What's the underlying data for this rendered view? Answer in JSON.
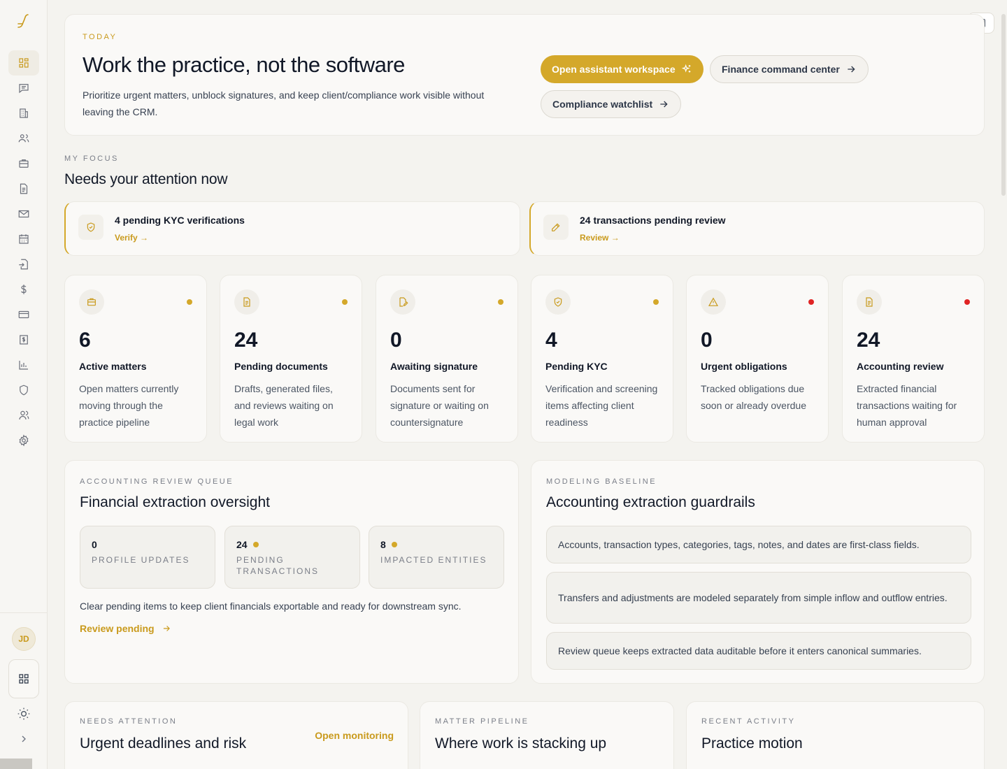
{
  "hero": {
    "eyebrow": "TODAY",
    "title": "Work the practice, not the software",
    "description": "Prioritize urgent matters, unblock signatures, and keep client/compliance work visible without leaving the CRM.",
    "btn_assistant": "Open assistant workspace",
    "btn_finance": "Finance command center",
    "btn_compliance": "Compliance watchlist"
  },
  "focus": {
    "eyebrow": "MY FOCUS",
    "title": "Needs your attention now",
    "alerts": [
      {
        "title": "4 pending KYC verifications",
        "link": "Verify",
        "icon": "shield-icon"
      },
      {
        "title": "24 transactions pending review",
        "link": "Review",
        "icon": "pencil-icon"
      }
    ]
  },
  "stats": [
    {
      "value": "6",
      "name": "Active matters",
      "desc": "Open matters currently moving through the practice pipeline",
      "icon": "briefcase-icon",
      "dot": "#d4a82a"
    },
    {
      "value": "24",
      "name": "Pending documents",
      "desc": "Drafts, generated files, and reviews waiting on legal work",
      "icon": "document-icon",
      "dot": "#d4a82a"
    },
    {
      "value": "0",
      "name": "Awaiting signature",
      "desc": "Documents sent for signature or waiting on countersignature",
      "icon": "signature-icon",
      "dot": "#d4a82a"
    },
    {
      "value": "4",
      "name": "Pending KYC",
      "desc": "Verification and screening items affecting client readiness",
      "icon": "shield-icon",
      "dot": "#d4a82a"
    },
    {
      "value": "0",
      "name": "Urgent obligations",
      "desc": "Tracked obligations due soon or already overdue",
      "icon": "warning-icon",
      "dot": "#e02424"
    },
    {
      "value": "24",
      "name": "Accounting review",
      "desc": "Extracted financial transactions waiting for human approval",
      "icon": "document-icon",
      "dot": "#e02424"
    }
  ],
  "accounting": {
    "eyebrow": "ACCOUNTING REVIEW QUEUE",
    "title": "Financial extraction oversight",
    "minis": [
      {
        "value": "0",
        "label": "PROFILE UPDATES",
        "dot": false
      },
      {
        "value": "24",
        "label": "PENDING TRANSACTIONS",
        "dot": true
      },
      {
        "value": "8",
        "label": "IMPACTED ENTITIES",
        "dot": true
      }
    ],
    "note": "Clear pending items to keep client financials exportable and ready for downstream sync.",
    "link": "Review pending"
  },
  "modeling": {
    "eyebrow": "MODELING BASELINE",
    "title": "Accounting extraction guardrails",
    "rules": [
      "Accounts, transaction types, categories, tags, notes, and dates are first-class fields.",
      "Transfers and adjustments are modeled separately from simple inflow and outflow entries.",
      "Review queue keeps extracted data auditable before it enters canonical summaries."
    ]
  },
  "needs": {
    "eyebrow": "NEEDS ATTENTION",
    "title": "Urgent deadlines and risk",
    "link": "Open monitoring"
  },
  "pipeline": {
    "eyebrow": "MATTER PIPELINE",
    "title": "Where work is stacking up"
  },
  "activity": {
    "eyebrow": "RECENT ACTIVITY",
    "title": "Practice motion"
  },
  "user": {
    "initials": "JD"
  },
  "colors": {
    "accent": "#d4a82a",
    "danger": "#e02424"
  }
}
